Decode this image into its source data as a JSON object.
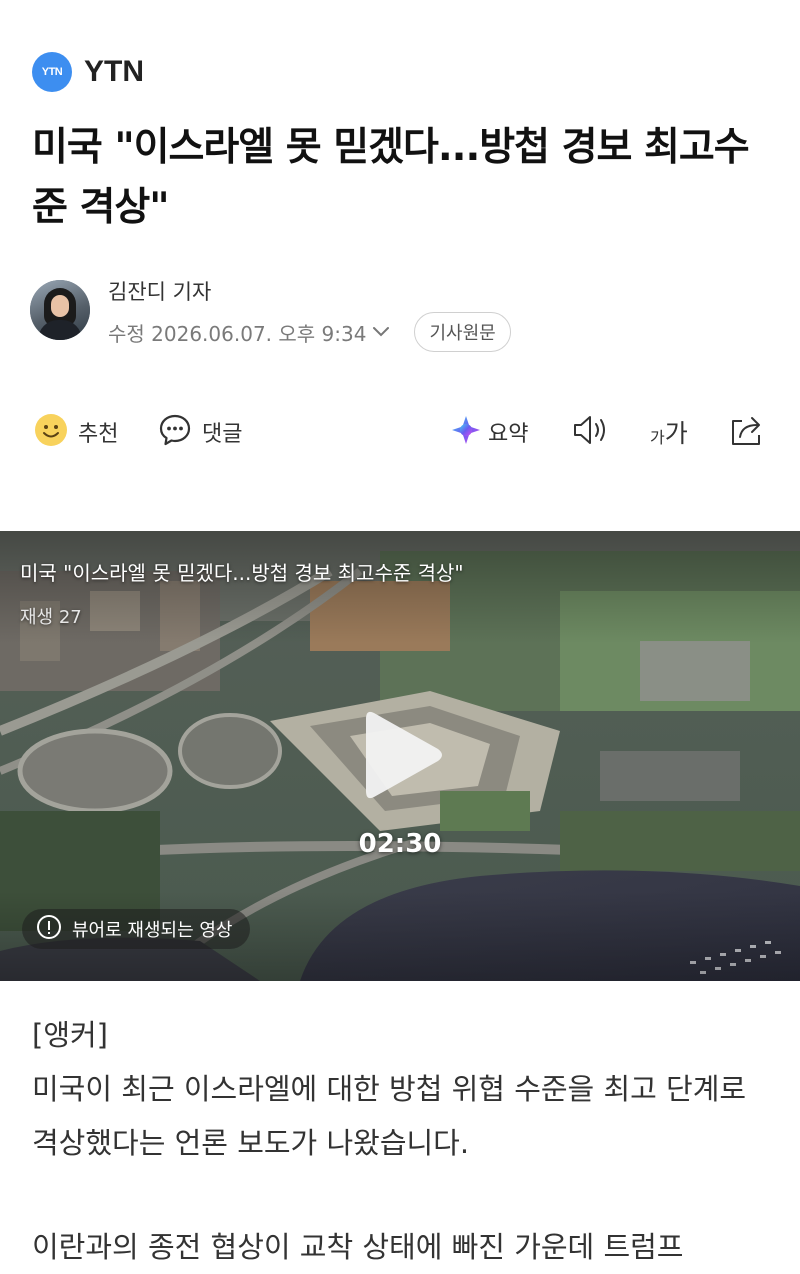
{
  "press": {
    "logo_text": "YTN",
    "name": "YTN",
    "logo_color": "#3d8ef0"
  },
  "headline": "미국 \"이스라엘 못 믿겠다...방첩 경보 최고수준 격상\"",
  "reporter": {
    "name": "김잔디 기자",
    "modified": "수정 2026.06.07. 오후 9:34",
    "original_button": "기사원문"
  },
  "actions": {
    "recommend": "추천",
    "comment": "댓글",
    "summary": "요약",
    "font_size_small": "가",
    "font_size_large": "가"
  },
  "video": {
    "title": "미국 \"이스라엘 못 믿겠다...방첩 경보 최고수준 격상\"",
    "play_count": "재생 27",
    "duration": "02:30",
    "viewer_notice": "뷰어로 재생되는 영상"
  },
  "article": {
    "tag": "[앵커]",
    "paragraphs": [
      "미국이 최근 이스라엘에 대한 방첩 위협 수준을 최고 단계로 격상했다는 언론 보도가 나왔습니다.",
      "이란과의 종전 협상이 교착 상태에 빠진 가운데 트럼프"
    ]
  }
}
